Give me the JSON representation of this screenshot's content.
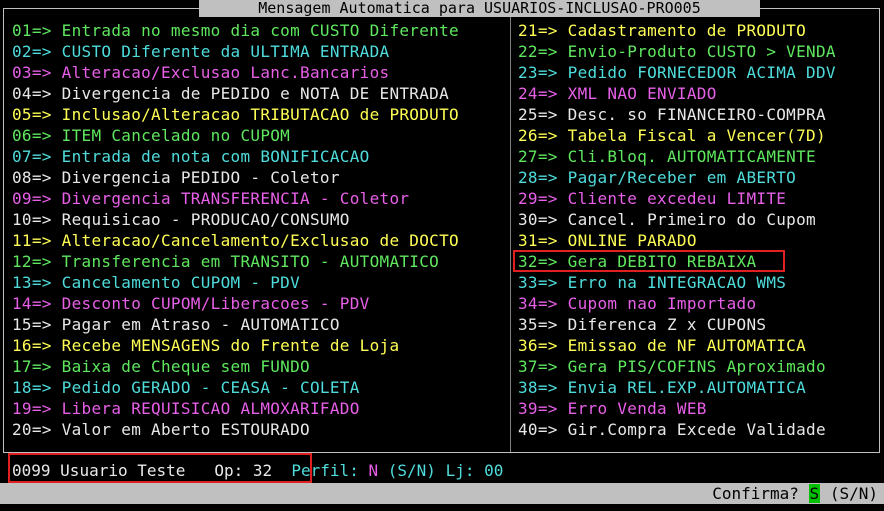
{
  "title": "Mensagem Automatica para USUARIOS-INCLUSAO-PRO005",
  "colors": {
    "green": "#5fe85f",
    "cyan": "#4fdcdc",
    "magenta": "#e85fe8",
    "white": "#e8e8e8",
    "yellow": "#ffff55"
  },
  "left_items": [
    {
      "text": "01=> Entrada no mesmo dia com CUSTO Diferente",
      "color": "green"
    },
    {
      "text": "02=> CUSTO Diferente da ULTIMA ENTRADA",
      "color": "cyan"
    },
    {
      "text": "03=> Alteracao/Exclusao Lanc.Bancarios",
      "color": "magenta"
    },
    {
      "text": "04=> Divergencia de PEDIDO e NOTA DE ENTRADA",
      "color": "white"
    },
    {
      "text": "05=> Inclusao/Alteracao TRIBUTACAO de PRODUTO",
      "color": "yellow"
    },
    {
      "text": "06=> ITEM Cancelado no CUPOM",
      "color": "green"
    },
    {
      "text": "07=> Entrada de nota com BONIFICACAO",
      "color": "cyan"
    },
    {
      "text": "08=> Divergencia PEDIDO - Coletor",
      "color": "white"
    },
    {
      "text": "09=> Divergencia TRANSFERENCIA - Coletor",
      "color": "magenta"
    },
    {
      "text": "10=> Requisicao - PRODUCAO/CONSUMO",
      "color": "white"
    },
    {
      "text": "11=> Alteracao/Cancelamento/Exclusao de DOCTO",
      "color": "yellow"
    },
    {
      "text": "12=> Transferencia em TRANSITO - AUTOMATICO",
      "color": "green"
    },
    {
      "text": "13=> Cancelamento CUPOM - PDV",
      "color": "cyan"
    },
    {
      "text": "14=> Desconto CUPOM/Liberacoes - PDV",
      "color": "magenta"
    },
    {
      "text": "15=> Pagar em Atraso - AUTOMATICO",
      "color": "white"
    },
    {
      "text": "16=> Recebe MENSAGENS do Frente de Loja",
      "color": "yellow"
    },
    {
      "text": "17=> Baixa de Cheque sem FUNDO",
      "color": "green"
    },
    {
      "text": "18=> Pedido GERADO - CEASA - COLETA",
      "color": "cyan"
    },
    {
      "text": "19=> Libera REQUISICAO ALMOXARIFADO",
      "color": "magenta"
    },
    {
      "text": "20=> Valor em Aberto ESTOURADO",
      "color": "white"
    }
  ],
  "right_items": [
    {
      "text": "21=> Cadastramento de PRODUTO",
      "color": "yellow"
    },
    {
      "text": "22=> Envio-Produto CUSTO > VENDA",
      "color": "green"
    },
    {
      "text": "23=> Pedido FORNECEDOR ACIMA DDV",
      "color": "cyan"
    },
    {
      "text": "24=> XML NAO ENVIADO",
      "color": "magenta"
    },
    {
      "text": "25=> Desc. so FINANCEIRO-COMPRA",
      "color": "white"
    },
    {
      "text": "26=> Tabela Fiscal a Vencer(7D)",
      "color": "yellow"
    },
    {
      "text": "27=> Cli.Bloq. AUTOMATICAMENTE",
      "color": "green"
    },
    {
      "text": "28=> Pagar/Receber em ABERTO",
      "color": "cyan"
    },
    {
      "text": "29=> Cliente excedeu LIMITE",
      "color": "magenta"
    },
    {
      "text": "30=> Cancel. Primeiro do Cupom",
      "color": "white"
    },
    {
      "text": "31=> ONLINE PARADO",
      "color": "yellow"
    },
    {
      "text": "32=> Gera DEBITO REBAIXA",
      "color": "green"
    },
    {
      "text": "33=> Erro na INTEGRACAO WMS",
      "color": "cyan"
    },
    {
      "text": "34=> Cupom nao Importado",
      "color": "magenta"
    },
    {
      "text": "35=> Diferenca Z x CUPONS",
      "color": "white"
    },
    {
      "text": "36=> Emissao de NF AUTOMATICA",
      "color": "yellow"
    },
    {
      "text": "37=> Gera PIS/COFINS Aproximado",
      "color": "green"
    },
    {
      "text": "38=> Envia REL.EXP.AUTOMATICA",
      "color": "cyan"
    },
    {
      "text": "39=> Erro Venda WEB",
      "color": "magenta"
    },
    {
      "text": "40=> Gir.Compra Excede Validade",
      "color": "white"
    }
  ],
  "status": {
    "user_code": "0099",
    "user_name": "Usuario Teste",
    "op_label": "Op:",
    "op_value": "32",
    "perfil_label": "Perfil:",
    "perfil_value": "N",
    "perfil_options": "(S/N)",
    "lj_label": "Lj:",
    "lj_value": "00"
  },
  "confirm": {
    "label": "Confirma?",
    "value": "S",
    "options": "(S/N)"
  }
}
